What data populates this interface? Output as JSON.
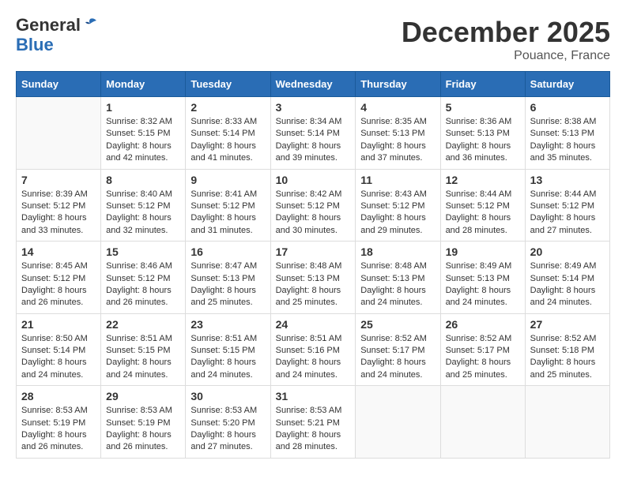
{
  "logo": {
    "general": "General",
    "blue": "Blue"
  },
  "header": {
    "month": "December 2025",
    "location": "Pouance, France"
  },
  "weekdays": [
    "Sunday",
    "Monday",
    "Tuesday",
    "Wednesday",
    "Thursday",
    "Friday",
    "Saturday"
  ],
  "weeks": [
    [
      {
        "day": "",
        "sunrise": "",
        "sunset": "",
        "daylight": ""
      },
      {
        "day": "1",
        "sunrise": "Sunrise: 8:32 AM",
        "sunset": "Sunset: 5:15 PM",
        "daylight": "Daylight: 8 hours and 42 minutes."
      },
      {
        "day": "2",
        "sunrise": "Sunrise: 8:33 AM",
        "sunset": "Sunset: 5:14 PM",
        "daylight": "Daylight: 8 hours and 41 minutes."
      },
      {
        "day": "3",
        "sunrise": "Sunrise: 8:34 AM",
        "sunset": "Sunset: 5:14 PM",
        "daylight": "Daylight: 8 hours and 39 minutes."
      },
      {
        "day": "4",
        "sunrise": "Sunrise: 8:35 AM",
        "sunset": "Sunset: 5:13 PM",
        "daylight": "Daylight: 8 hours and 37 minutes."
      },
      {
        "day": "5",
        "sunrise": "Sunrise: 8:36 AM",
        "sunset": "Sunset: 5:13 PM",
        "daylight": "Daylight: 8 hours and 36 minutes."
      },
      {
        "day": "6",
        "sunrise": "Sunrise: 8:38 AM",
        "sunset": "Sunset: 5:13 PM",
        "daylight": "Daylight: 8 hours and 35 minutes."
      }
    ],
    [
      {
        "day": "7",
        "sunrise": "Sunrise: 8:39 AM",
        "sunset": "Sunset: 5:12 PM",
        "daylight": "Daylight: 8 hours and 33 minutes."
      },
      {
        "day": "8",
        "sunrise": "Sunrise: 8:40 AM",
        "sunset": "Sunset: 5:12 PM",
        "daylight": "Daylight: 8 hours and 32 minutes."
      },
      {
        "day": "9",
        "sunrise": "Sunrise: 8:41 AM",
        "sunset": "Sunset: 5:12 PM",
        "daylight": "Daylight: 8 hours and 31 minutes."
      },
      {
        "day": "10",
        "sunrise": "Sunrise: 8:42 AM",
        "sunset": "Sunset: 5:12 PM",
        "daylight": "Daylight: 8 hours and 30 minutes."
      },
      {
        "day": "11",
        "sunrise": "Sunrise: 8:43 AM",
        "sunset": "Sunset: 5:12 PM",
        "daylight": "Daylight: 8 hours and 29 minutes."
      },
      {
        "day": "12",
        "sunrise": "Sunrise: 8:44 AM",
        "sunset": "Sunset: 5:12 PM",
        "daylight": "Daylight: 8 hours and 28 minutes."
      },
      {
        "day": "13",
        "sunrise": "Sunrise: 8:44 AM",
        "sunset": "Sunset: 5:12 PM",
        "daylight": "Daylight: 8 hours and 27 minutes."
      }
    ],
    [
      {
        "day": "14",
        "sunrise": "Sunrise: 8:45 AM",
        "sunset": "Sunset: 5:12 PM",
        "daylight": "Daylight: 8 hours and 26 minutes."
      },
      {
        "day": "15",
        "sunrise": "Sunrise: 8:46 AM",
        "sunset": "Sunset: 5:12 PM",
        "daylight": "Daylight: 8 hours and 26 minutes."
      },
      {
        "day": "16",
        "sunrise": "Sunrise: 8:47 AM",
        "sunset": "Sunset: 5:13 PM",
        "daylight": "Daylight: 8 hours and 25 minutes."
      },
      {
        "day": "17",
        "sunrise": "Sunrise: 8:48 AM",
        "sunset": "Sunset: 5:13 PM",
        "daylight": "Daylight: 8 hours and 25 minutes."
      },
      {
        "day": "18",
        "sunrise": "Sunrise: 8:48 AM",
        "sunset": "Sunset: 5:13 PM",
        "daylight": "Daylight: 8 hours and 24 minutes."
      },
      {
        "day": "19",
        "sunrise": "Sunrise: 8:49 AM",
        "sunset": "Sunset: 5:13 PM",
        "daylight": "Daylight: 8 hours and 24 minutes."
      },
      {
        "day": "20",
        "sunrise": "Sunrise: 8:49 AM",
        "sunset": "Sunset: 5:14 PM",
        "daylight": "Daylight: 8 hours and 24 minutes."
      }
    ],
    [
      {
        "day": "21",
        "sunrise": "Sunrise: 8:50 AM",
        "sunset": "Sunset: 5:14 PM",
        "daylight": "Daylight: 8 hours and 24 minutes."
      },
      {
        "day": "22",
        "sunrise": "Sunrise: 8:51 AM",
        "sunset": "Sunset: 5:15 PM",
        "daylight": "Daylight: 8 hours and 24 minutes."
      },
      {
        "day": "23",
        "sunrise": "Sunrise: 8:51 AM",
        "sunset": "Sunset: 5:15 PM",
        "daylight": "Daylight: 8 hours and 24 minutes."
      },
      {
        "day": "24",
        "sunrise": "Sunrise: 8:51 AM",
        "sunset": "Sunset: 5:16 PM",
        "daylight": "Daylight: 8 hours and 24 minutes."
      },
      {
        "day": "25",
        "sunrise": "Sunrise: 8:52 AM",
        "sunset": "Sunset: 5:17 PM",
        "daylight": "Daylight: 8 hours and 24 minutes."
      },
      {
        "day": "26",
        "sunrise": "Sunrise: 8:52 AM",
        "sunset": "Sunset: 5:17 PM",
        "daylight": "Daylight: 8 hours and 25 minutes."
      },
      {
        "day": "27",
        "sunrise": "Sunrise: 8:52 AM",
        "sunset": "Sunset: 5:18 PM",
        "daylight": "Daylight: 8 hours and 25 minutes."
      }
    ],
    [
      {
        "day": "28",
        "sunrise": "Sunrise: 8:53 AM",
        "sunset": "Sunset: 5:19 PM",
        "daylight": "Daylight: 8 hours and 26 minutes."
      },
      {
        "day": "29",
        "sunrise": "Sunrise: 8:53 AM",
        "sunset": "Sunset: 5:19 PM",
        "daylight": "Daylight: 8 hours and 26 minutes."
      },
      {
        "day": "30",
        "sunrise": "Sunrise: 8:53 AM",
        "sunset": "Sunset: 5:20 PM",
        "daylight": "Daylight: 8 hours and 27 minutes."
      },
      {
        "day": "31",
        "sunrise": "Sunrise: 8:53 AM",
        "sunset": "Sunset: 5:21 PM",
        "daylight": "Daylight: 8 hours and 28 minutes."
      },
      {
        "day": "",
        "sunrise": "",
        "sunset": "",
        "daylight": ""
      },
      {
        "day": "",
        "sunrise": "",
        "sunset": "",
        "daylight": ""
      },
      {
        "day": "",
        "sunrise": "",
        "sunset": "",
        "daylight": ""
      }
    ]
  ]
}
